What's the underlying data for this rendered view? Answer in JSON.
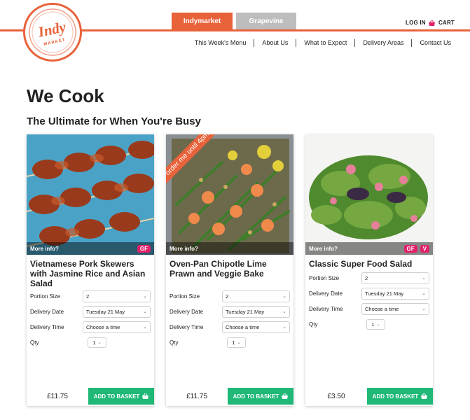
{
  "logo": {
    "line1": "Indy",
    "line2": "MARKET"
  },
  "tabs": [
    {
      "label": "Indymarket"
    },
    {
      "label": "Grapevine"
    }
  ],
  "header": {
    "login": "LOG IN",
    "cart": "CART"
  },
  "nav": [
    {
      "label": "This Week's Menu"
    },
    {
      "label": "About Us"
    },
    {
      "label": "What to Expect"
    },
    {
      "label": "Delivery Areas"
    },
    {
      "label": "Contact Us"
    }
  ],
  "page": {
    "title": "We Cook",
    "subtitle": "The Ultimate for When You're Busy"
  },
  "labels": {
    "more_info": "More info?",
    "portion": "Portion Size",
    "date": "Delivery Date",
    "time": "Delivery Time",
    "qty": "Qty",
    "add": "ADD TO BASKET"
  },
  "colors": {
    "brand": "#e8623a",
    "add_button": "#1fb877",
    "badge": "#e2216b",
    "inactive_tab": "#bdbdbd"
  },
  "cards": [
    {
      "name": "Vietnamese Pork Skewers with Jasmine Rice and Asian Salad",
      "badges": [
        "GF"
      ],
      "ribbon": "",
      "portion": "2",
      "date": "Tuesday 21 May",
      "time": "Choose a time",
      "qty": "1",
      "price": "£11.75"
    },
    {
      "name": "Oven-Pan Chipotle Lime Prawn and Veggie Bake",
      "badges": [],
      "ribbon": "order me until 4pm",
      "portion": "2",
      "date": "Tuesday 21 May",
      "time": "Choose a time",
      "qty": "1",
      "price": "£11.75"
    },
    {
      "name": "Classic Super Food Salad",
      "badges": [
        "GF",
        "V"
      ],
      "ribbon": "",
      "portion": "2",
      "date": "Tuesday 21 May",
      "time": "Choose a time",
      "qty": "1",
      "price": "£3.50"
    }
  ]
}
